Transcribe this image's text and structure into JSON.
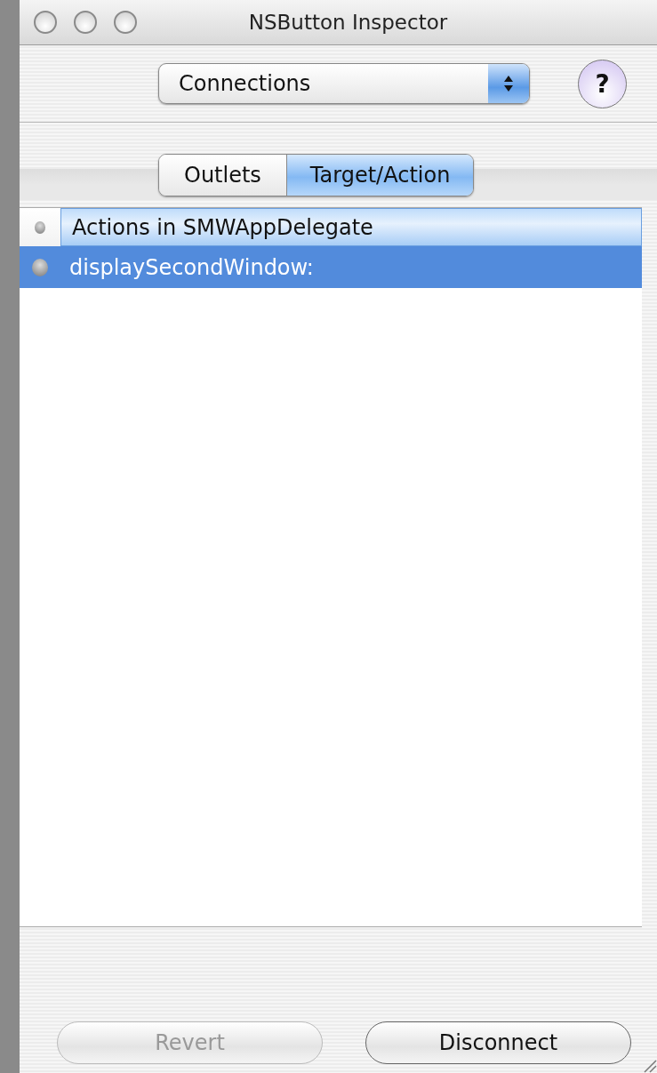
{
  "window": {
    "title": "NSButton Inspector"
  },
  "inspector_popup": {
    "value": "Connections"
  },
  "help_button": {
    "label": "?"
  },
  "tabs": [
    {
      "label": "Outlets",
      "selected": false
    },
    {
      "label": "Target/Action",
      "selected": true
    }
  ],
  "table": {
    "header": "Actions in SMWAppDelegate",
    "rows": [
      {
        "label": "displaySecondWindow:",
        "selected": true
      }
    ]
  },
  "buttons": [
    {
      "label": "Revert",
      "disabled": true
    },
    {
      "label": "Disconnect",
      "disabled": false
    }
  ]
}
